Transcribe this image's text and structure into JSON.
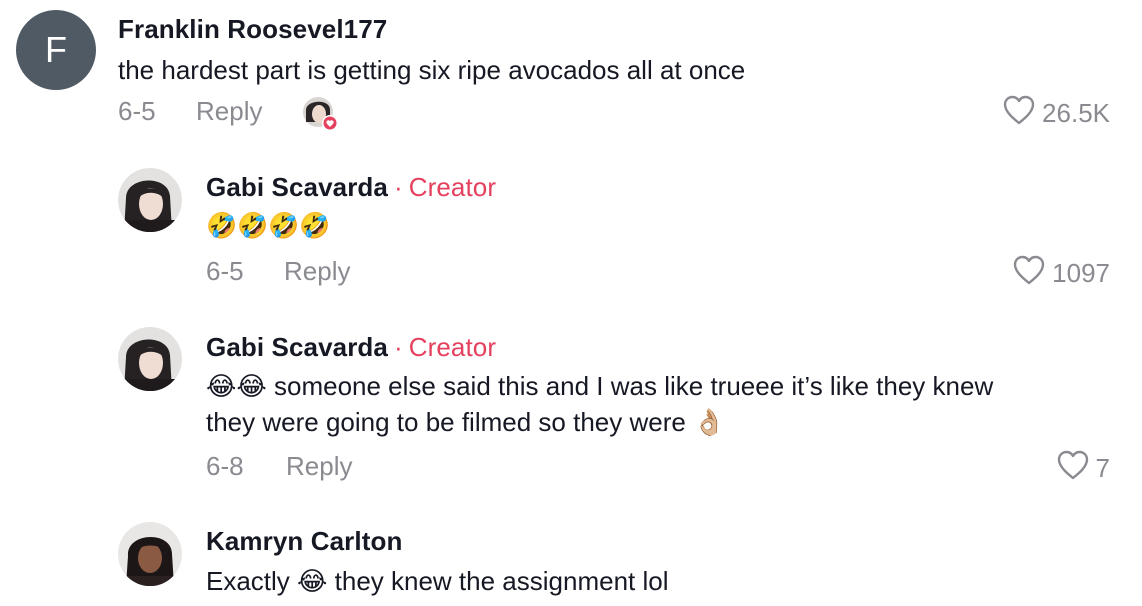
{
  "comments": [
    {
      "avatar_letter": "F",
      "username": "Franklin Roosevel177",
      "text": "the hardest part is getting six ripe avocados all at once",
      "date": "6-5",
      "reply_label": "Reply",
      "likes": "26.5K"
    },
    {
      "username": "Gabi Scavarda",
      "creator_dot": "·",
      "creator_label": "Creator",
      "text": "🤣🤣🤣🤣",
      "date": "6-5",
      "reply_label": "Reply",
      "likes": "1097"
    },
    {
      "username": "Gabi Scavarda",
      "creator_dot": "·",
      "creator_label": "Creator",
      "text_line1_emoji": "😂😂",
      "text_line1": " someone else said this and I was like trueee it’s like they knew",
      "text_line2": "they were going to be filmed so they were",
      "text_line2_emoji": "👌🏼",
      "date": "6-8",
      "reply_label": "Reply",
      "likes": "7"
    },
    {
      "username": "Kamryn Carlton",
      "text_part1": "Exactly ",
      "text_emoji": "😂",
      "text_part2": " they knew the assignment lol"
    }
  ],
  "colors": {
    "creator": "#e5405e",
    "meta": "#8a8b91",
    "text": "#161823",
    "avatar_bg": "#505a64"
  }
}
